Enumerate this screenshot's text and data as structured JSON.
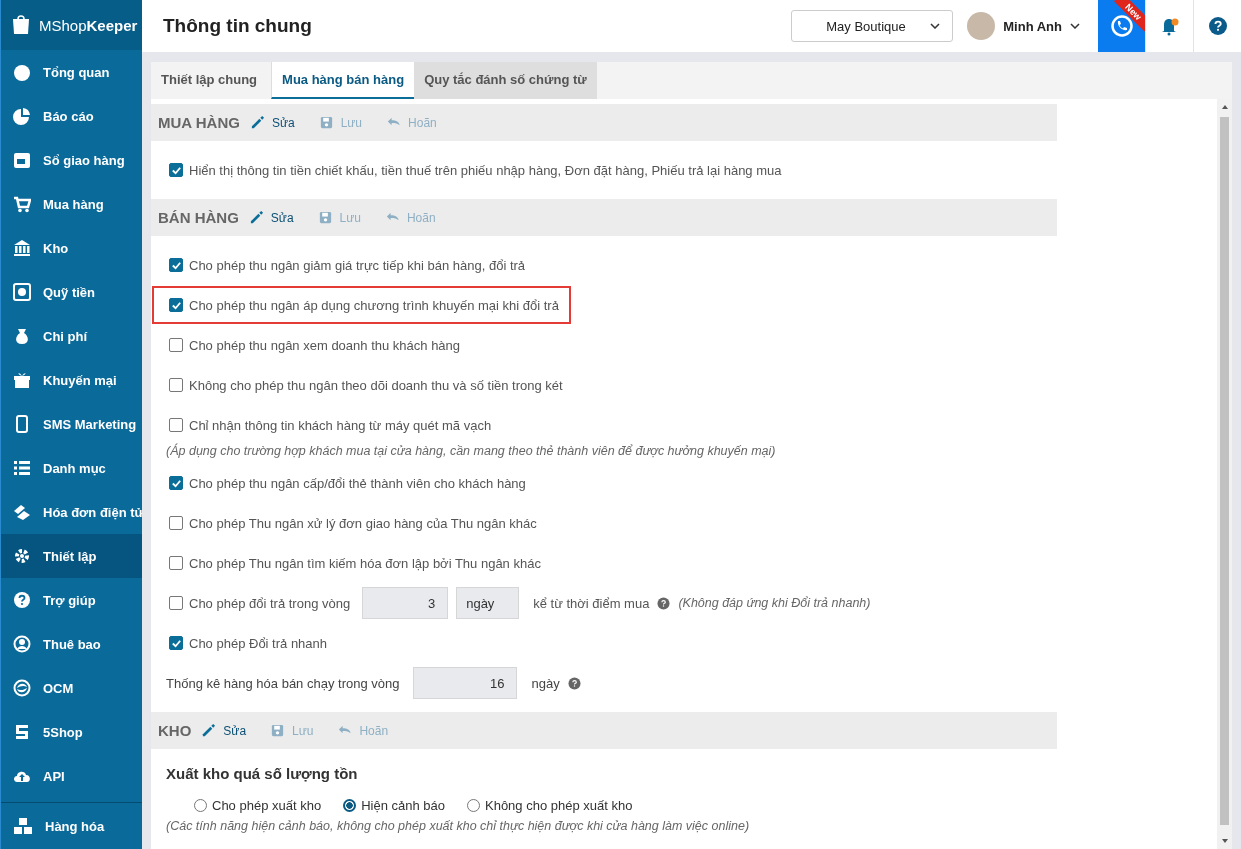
{
  "app": {
    "logo_light": "MShop",
    "logo_bold": "Keeper"
  },
  "sidebar": {
    "items": [
      {
        "label": "Tổng quan",
        "selected": false
      },
      {
        "label": "Báo cáo",
        "selected": false
      },
      {
        "label": "Sổ giao hàng",
        "selected": false
      },
      {
        "label": "Mua hàng",
        "selected": false
      },
      {
        "label": "Kho",
        "selected": false
      },
      {
        "label": "Quỹ tiền",
        "selected": false
      },
      {
        "label": "Chi phí",
        "selected": false
      },
      {
        "label": "Khuyến mại",
        "selected": false
      },
      {
        "label": "SMS Marketing",
        "selected": false
      },
      {
        "label": "Danh mục",
        "selected": false
      },
      {
        "label": "Hóa đơn điện tử",
        "selected": false
      },
      {
        "label": "Thiết lập",
        "selected": true
      },
      {
        "label": "Trợ giúp",
        "selected": false
      },
      {
        "label": "Thuê bao",
        "selected": false
      },
      {
        "label": "OCM",
        "selected": false
      },
      {
        "label": "5Shop",
        "selected": false
      },
      {
        "label": "API",
        "selected": false
      }
    ],
    "bottom_item": {
      "label": "Hàng hóa",
      "selected": false
    }
  },
  "header": {
    "title": "Thông tin chung",
    "store": "May Boutique",
    "user": "Minh Anh",
    "badge": "New",
    "notification": true
  },
  "tabs": [
    {
      "label": "Thiết lập chung",
      "selected": false
    },
    {
      "label": "Mua hàng bán hàng",
      "selected": true
    },
    {
      "label": "Quy tắc đánh số chứng từ",
      "selected": false
    }
  ],
  "sections": [
    {
      "title": "MUA HÀNG",
      "actions": [
        {
          "kind": "edit",
          "label": "Sửa",
          "disabled": false
        },
        {
          "kind": "save",
          "label": "Lưu",
          "disabled": true
        },
        {
          "kind": "undo",
          "label": "Hoãn",
          "disabled": true
        }
      ],
      "options": [
        {
          "kind": "checkbox",
          "label": "Hiển thị thông tin tiền chiết khấu, tiền thuế trên phiếu nhập hàng, Đơn đặt hàng, Phiếu trả lại hàng mua",
          "checked": true,
          "highlighted": false
        }
      ]
    },
    {
      "title": "BÁN HÀNG",
      "actions": [
        {
          "kind": "edit",
          "label": "Sửa",
          "disabled": false
        },
        {
          "kind": "save",
          "label": "Lưu",
          "disabled": true
        },
        {
          "kind": "undo",
          "label": "Hoãn",
          "disabled": true
        }
      ],
      "options": [
        {
          "kind": "checkbox",
          "label": "Cho phép thu ngân giảm giá trực tiếp khi bán hàng, đổi trả",
          "checked": true,
          "highlighted": false
        },
        {
          "kind": "checkbox",
          "label": "Cho phép thu ngân áp dụng chương trình khuyến mại khi đổi trả",
          "checked": true,
          "highlighted": true
        },
        {
          "kind": "checkbox",
          "label": "Cho phép thu ngân xem doanh thu khách hàng",
          "checked": false,
          "highlighted": false
        },
        {
          "kind": "checkbox",
          "label": "Không cho phép thu ngân theo dõi doanh thu và số tiền trong két",
          "checked": false,
          "highlighted": false
        },
        {
          "kind": "checkbox",
          "label": "Chỉ nhận thông tin khách hàng từ máy quét mã vạch",
          "checked": false,
          "highlighted": false
        },
        {
          "kind": "note",
          "label": "(Áp dụng cho trường hợp khách mua tại cửa hàng, cần mang theo thẻ thành viên để được hưởng khuyến mại)"
        },
        {
          "kind": "checkbox",
          "label": "Cho phép thu ngân cấp/đổi thẻ thành viên cho khách hàng",
          "checked": true,
          "highlighted": false
        },
        {
          "kind": "checkbox",
          "label": "Cho phép Thu ngân xử lý đơn giao hàng của Thu ngân khác",
          "checked": false,
          "highlighted": false
        },
        {
          "kind": "checkbox",
          "label": "Cho phép Thu ngân tìm kiếm hóa đơn lập bởi Thu ngân khác",
          "checked": false,
          "highlighted": false
        },
        {
          "kind": "period",
          "label": "Cho phép đổi trả trong vòng",
          "checked": false,
          "highlighted": false,
          "value": "3",
          "unit": "ngày",
          "suffix": "kể từ thời điểm mua",
          "hint": "(Không đáp ứng khi Đổi trả nhanh)"
        },
        {
          "kind": "checkbox",
          "label": "Cho phép Đổi trả nhanh",
          "checked": true,
          "highlighted": false
        },
        {
          "kind": "stat",
          "label": "Thống kê hàng hóa bán chạy trong vòng",
          "value": "16",
          "unit": "ngày"
        }
      ]
    },
    {
      "title": "KHO",
      "actions": [
        {
          "kind": "edit",
          "label": "Sửa",
          "disabled": false
        },
        {
          "kind": "save",
          "label": "Lưu",
          "disabled": true
        },
        {
          "kind": "undo",
          "label": "Hoãn",
          "disabled": true
        }
      ],
      "options": [
        {
          "kind": "heading",
          "label": "Xuất kho quá số lượng tồn"
        },
        {
          "kind": "radios",
          "choices": [
            {
              "label": "Cho phép xuất kho",
              "selected": false
            },
            {
              "label": "Hiện cảnh báo",
              "selected": true
            },
            {
              "label": "Không cho phép xuất kho",
              "selected": false
            }
          ]
        },
        {
          "kind": "note",
          "label": "(Các tính năng hiện cảnh báo, không cho phép xuất kho chỉ thực hiện được khi cửa hàng làm việc online)"
        }
      ]
    }
  ]
}
